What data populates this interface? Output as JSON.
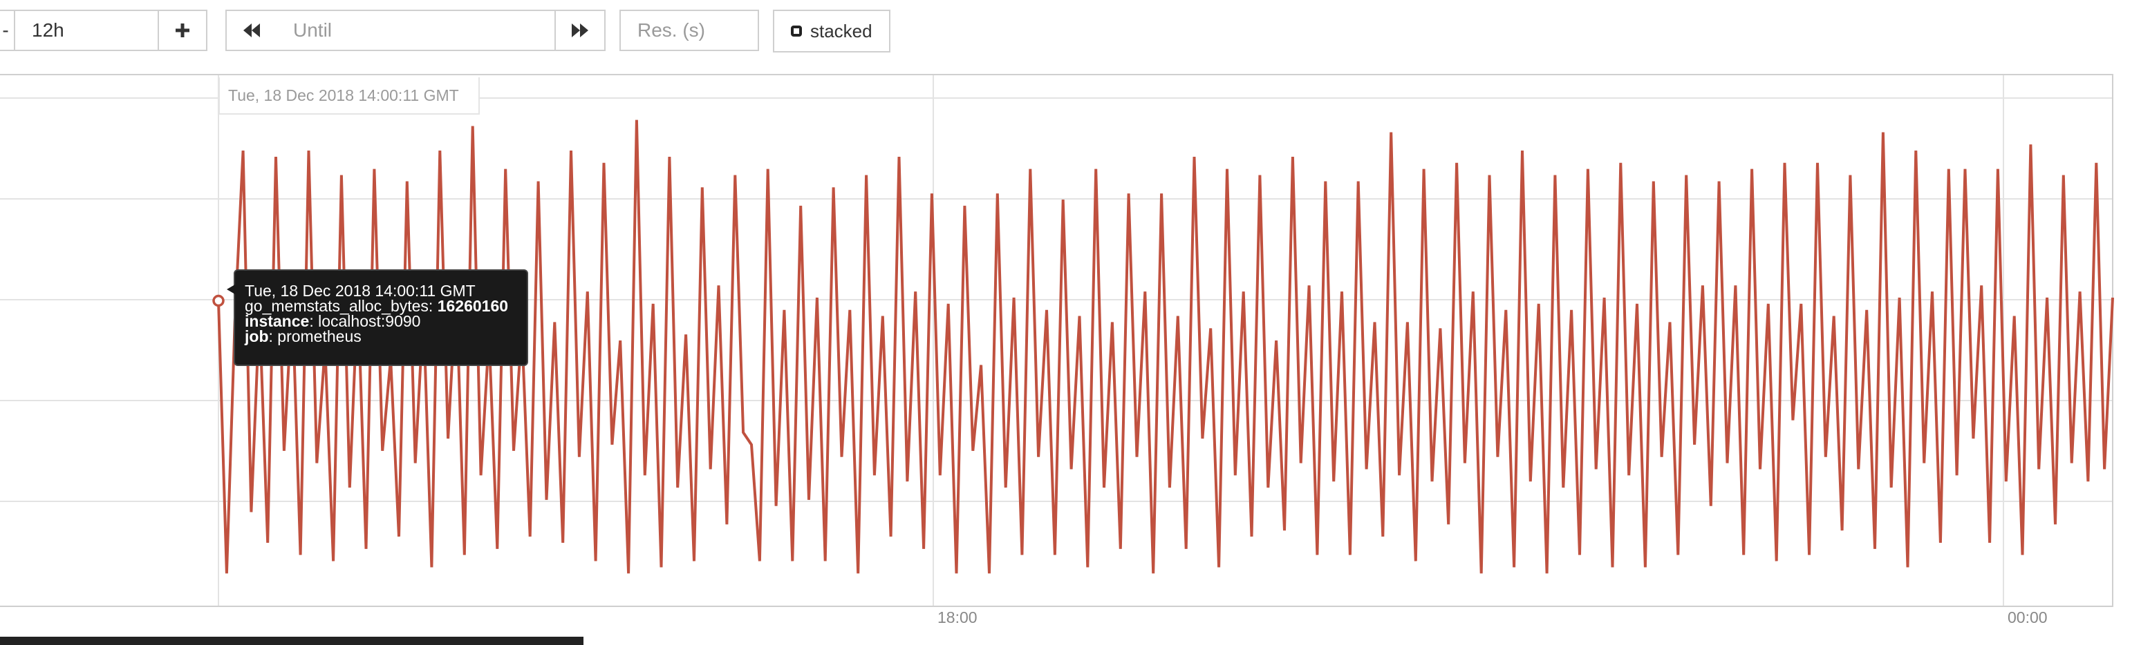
{
  "toolbar": {
    "minus_label": "-",
    "range_value": "12h",
    "plus_label": "+",
    "prev_icon": "backward-icon",
    "until_placeholder": "Until",
    "next_icon": "forward-icon",
    "resolution_placeholder": "Res. (s)",
    "stacked_label": "stacked"
  },
  "graph": {
    "hover_date": "Tue, 18 Dec 2018 14:00:11 GMT",
    "x_tick_labels": [
      "18:00",
      "00:00"
    ],
    "line_color": "#c0513f",
    "grid_color": "#e3e3e3"
  },
  "tooltip": {
    "date": "Tue, 18 Dec 2018 14:00:11 GMT",
    "metric_name": "go_memstats_alloc_bytes:",
    "metric_value": "16260160",
    "instance_key": "instance",
    "instance_value": ": localhost:9090",
    "job_key": "job",
    "job_value": ": prometheus"
  },
  "chart_data": {
    "type": "line",
    "series": [
      {
        "values": [
          15.45,
          11.0,
          15.1,
          17.9,
          12.0,
          15.3,
          11.5,
          17.8,
          13.0,
          15.5,
          11.3,
          17.9,
          12.8,
          14.7,
          11.2,
          17.5,
          12.4,
          15.6,
          11.4,
          17.6,
          13.0,
          14.5,
          11.6,
          17.4,
          12.8,
          15.3,
          11.1,
          17.9,
          13.2,
          15.7,
          11.3,
          18.3,
          12.6,
          14.9,
          11.4,
          17.6,
          13.0,
          15.0,
          11.6,
          17.4,
          12.2,
          15.1,
          11.5,
          17.9,
          12.9,
          15.6,
          11.2,
          17.7,
          13.1,
          14.8,
          11.0,
          18.4,
          12.6,
          15.4,
          11.1,
          17.8,
          12.4,
          14.9,
          11.2,
          17.3,
          12.7,
          15.7,
          11.8,
          17.5,
          13.3,
          13.1,
          11.2,
          17.6,
          12.1,
          15.3,
          11.2,
          17.0,
          12.2,
          15.5,
          11.2,
          17.3,
          12.9,
          15.3,
          11.0,
          17.5,
          12.6,
          15.2,
          11.6,
          17.8,
          12.5,
          15.6,
          11.4,
          17.2,
          12.6,
          15.4,
          11.0,
          17.0,
          13.0,
          14.4,
          11.0,
          17.2,
          12.4,
          15.5,
          11.3,
          17.6,
          12.9,
          15.3,
          11.3,
          17.1,
          12.7,
          15.2,
          11.1,
          17.6,
          12.4,
          15.1,
          11.4,
          17.2,
          12.9,
          15.6,
          11.0,
          17.2,
          12.4,
          15.2,
          11.4,
          17.8,
          13.2,
          15.0,
          11.1,
          17.6,
          12.6,
          15.6,
          11.6,
          17.5,
          12.4,
          14.8,
          11.7,
          17.8,
          12.8,
          15.7,
          11.3,
          17.4,
          12.5,
          15.6,
          11.3,
          17.4,
          12.7,
          15.1,
          11.6,
          18.2,
          12.6,
          15.1,
          11.2,
          17.6,
          12.5,
          15.0,
          11.8,
          17.7,
          12.8,
          15.6,
          11.0,
          17.5,
          12.9,
          15.3,
          11.1,
          17.9,
          12.5,
          15.4,
          11.0,
          17.5,
          12.4,
          15.3,
          11.3,
          17.6,
          12.7,
          15.5,
          11.1,
          17.7,
          12.6,
          15.4,
          11.1,
          17.4,
          12.9,
          15.1,
          11.3,
          17.5,
          13.1,
          15.7,
          12.1,
          17.4,
          12.8,
          15.7,
          11.3,
          17.6,
          12.7,
          15.4,
          11.2,
          17.7,
          13.5,
          15.4,
          11.3,
          17.7,
          12.9,
          15.2,
          11.7,
          17.5,
          12.7,
          15.3,
          11.4,
          18.2,
          12.4,
          15.5,
          11.1,
          17.9,
          12.8,
          15.6,
          11.5,
          17.6,
          12.6,
          17.6,
          13.2,
          15.7,
          11.5,
          17.6,
          12.5,
          15.2,
          11.3,
          18.0,
          12.7,
          15.5,
          11.8,
          17.5,
          12.8,
          15.6,
          12.5,
          17.7,
          12.7,
          15.5
        ],
        "color": "#c0513f"
      }
    ],
    "x_ticks": [
      "18:00",
      "00:00"
    ],
    "xlabel": "",
    "ylabel": "",
    "grid": true
  }
}
